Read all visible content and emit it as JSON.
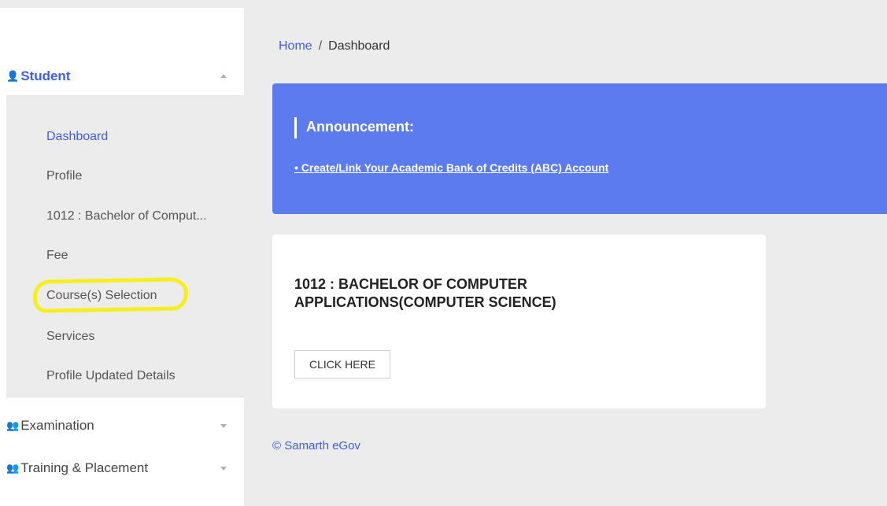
{
  "breadcrumb": {
    "home": "Home",
    "separator": "/",
    "current": "Dashboard"
  },
  "sidebar": {
    "student": {
      "icon": "user-icon",
      "label": "Student",
      "expanded": true
    },
    "items": [
      {
        "label": "Dashboard",
        "active": true
      },
      {
        "label": "Profile"
      },
      {
        "label": "1012 : Bachelor of Comput..."
      },
      {
        "label": "Fee"
      },
      {
        "label": "Course(s) Selection",
        "highlighted": true
      },
      {
        "label": "Services"
      },
      {
        "label": "Profile Updated Details"
      }
    ],
    "examination": {
      "icon": "group-icon",
      "label": "Examination",
      "expanded": false
    },
    "training": {
      "icon": "group-icon",
      "label": "Training & Placement",
      "expanded": false
    }
  },
  "announcement": {
    "title": "Announcement:",
    "link": "• Create/Link Your Academic Bank of Credits (ABC) Account"
  },
  "program_card": {
    "title": "1012 : BACHELOR OF COMPUTER APPLICATIONS(COMPUTER SCIENCE)",
    "button": "CLICK HERE"
  },
  "footer": {
    "text": "© Samarth eGov"
  },
  "colors": {
    "accent": "#3f5ee8",
    "announcement_bg": "#5b7bee",
    "highlight_marker": "#f6ee1f",
    "page_bg": "#ececec"
  }
}
